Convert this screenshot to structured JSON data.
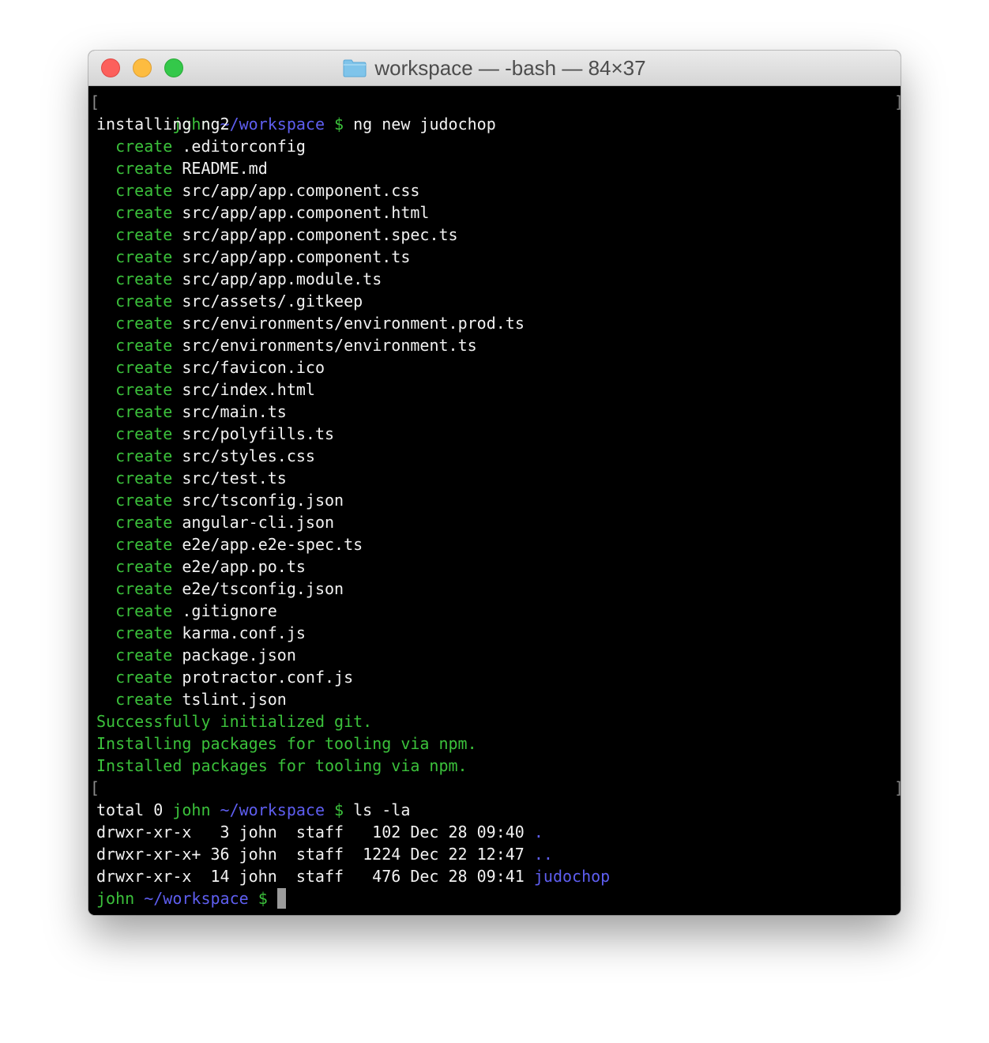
{
  "window": {
    "title": "workspace — -bash — 84×37",
    "folder_icon": "folder-icon",
    "controls": [
      "close-button",
      "minimize-button",
      "zoom-button"
    ]
  },
  "colors": {
    "prompt_user": "#3bc13b",
    "prompt_path": "#5e5ef0",
    "create_keyword": "#3bc13b",
    "success_text": "#3bc13b",
    "directory_link": "#5e5ef0",
    "default_text": "#f2f2f2"
  },
  "terminal": {
    "prompt1": {
      "user": "john",
      "path": "~/workspace",
      "symbol": "$",
      "command": "ng new judochop"
    },
    "installing": "installing ng2",
    "create_word": "create",
    "created_files": [
      ".editorconfig",
      "README.md",
      "src/app/app.component.css",
      "src/app/app.component.html",
      "src/app/app.component.spec.ts",
      "src/app/app.component.ts",
      "src/app/app.module.ts",
      "src/assets/.gitkeep",
      "src/environments/environment.prod.ts",
      "src/environments/environment.ts",
      "src/favicon.ico",
      "src/index.html",
      "src/main.ts",
      "src/polyfills.ts",
      "src/styles.css",
      "src/test.ts",
      "src/tsconfig.json",
      "angular-cli.json",
      "e2e/app.e2e-spec.ts",
      "e2e/app.po.ts",
      "e2e/tsconfig.json",
      ".gitignore",
      "karma.conf.js",
      "package.json",
      "protractor.conf.js",
      "tslint.json"
    ],
    "status_lines": [
      "Successfully initialized git.",
      "Installing packages for tooling via npm.",
      "Installed packages for tooling via npm."
    ],
    "prompt2": {
      "user": "john",
      "path": "~/workspace",
      "symbol": "$",
      "command": "ls -la"
    },
    "total_line": "total 0",
    "listing": [
      {
        "perms": "drwxr-xr-x ",
        "links": "3",
        "owner": "john",
        "group": "staff",
        "size": "102",
        "date": "Dec 28 09:40",
        "name": "."
      },
      {
        "perms": "drwxr-xr-x+",
        "links": "36",
        "owner": "john",
        "group": "staff",
        "size": "1224",
        "date": "Dec 22 12:47",
        "name": ".."
      },
      {
        "perms": "drwxr-xr-x ",
        "links": "14",
        "owner": "john",
        "group": "staff",
        "size": "476",
        "date": "Dec 28 09:41",
        "name": "judochop"
      }
    ],
    "prompt3": {
      "user": "john",
      "path": "~/workspace",
      "symbol": "$"
    }
  }
}
